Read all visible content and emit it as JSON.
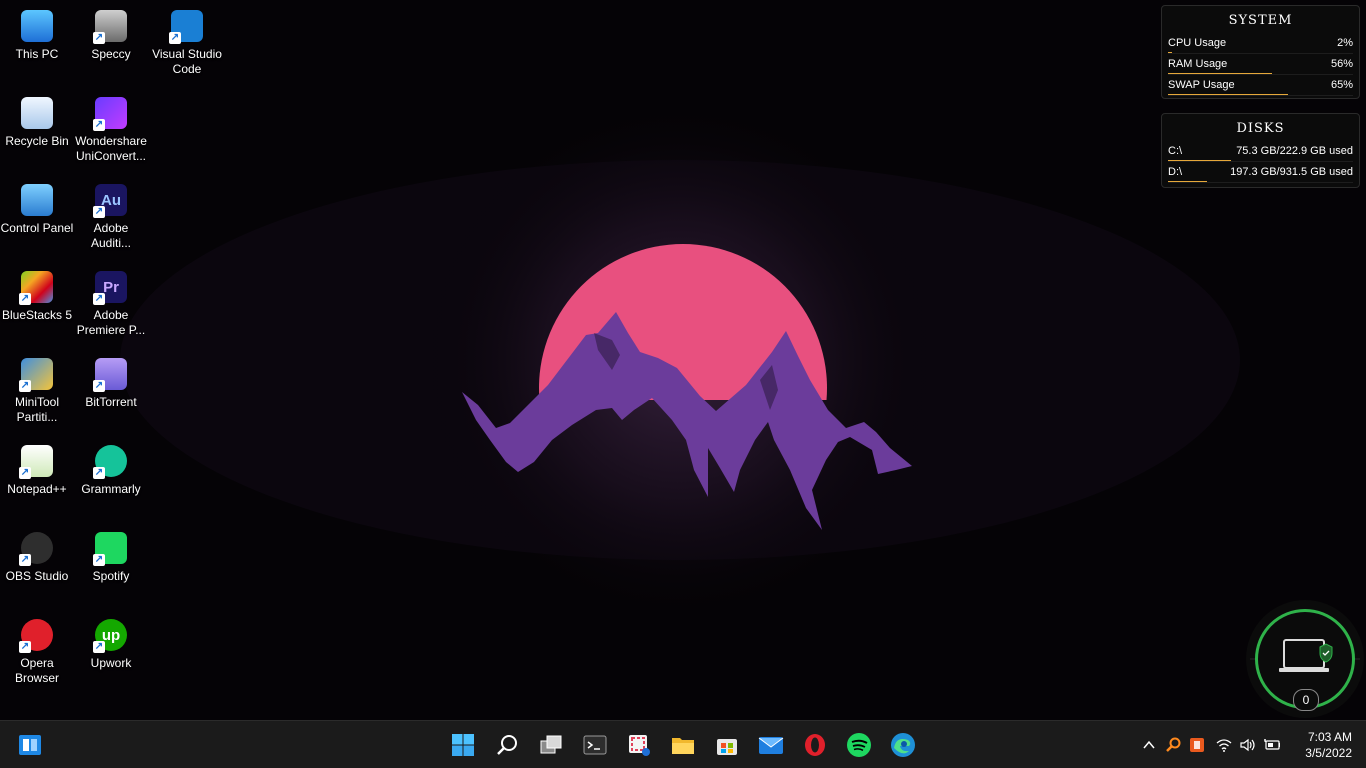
{
  "desktop": {
    "icons": [
      {
        "label": "This PC",
        "icon": "monitor-icon"
      },
      {
        "label": "Speccy",
        "icon": "speccy-icon"
      },
      {
        "label": "Visual Studio Code",
        "icon": "vscode-icon"
      },
      {
        "label": "Recycle Bin",
        "icon": "recycle-bin-icon"
      },
      {
        "label": "Wondershare UniConvert...",
        "icon": "uniconverter-icon"
      },
      {
        "label": "Control Panel",
        "icon": "control-panel-icon"
      },
      {
        "label": "Adobe Auditi...",
        "icon": "audition-icon",
        "glyph_text": "Au"
      },
      {
        "label": "BlueStacks 5",
        "icon": "bluestacks-icon"
      },
      {
        "label": "Adobe Premiere P...",
        "icon": "premiere-icon",
        "glyph_text": "Pr"
      },
      {
        "label": "MiniTool Partiti...",
        "icon": "minitool-icon"
      },
      {
        "label": "BitTorrent",
        "icon": "bittorrent-icon"
      },
      {
        "label": "Notepad++",
        "icon": "notepadpp-icon"
      },
      {
        "label": "Grammarly",
        "icon": "grammarly-icon"
      },
      {
        "label": "OBS Studio",
        "icon": "obs-icon"
      },
      {
        "label": "Spotify",
        "icon": "spotify-icon"
      },
      {
        "label": "Opera Browser",
        "icon": "opera-icon"
      },
      {
        "label": "Upwork",
        "icon": "upwork-icon",
        "glyph_text": "up"
      }
    ]
  },
  "system_widget": {
    "title": "SYSTEM",
    "rows": [
      {
        "label": "CPU Usage",
        "value": "2%",
        "fraction": 0.02
      },
      {
        "label": "RAM Usage",
        "value": "56%",
        "fraction": 0.56
      },
      {
        "label": "SWAP Usage",
        "value": "65%",
        "fraction": 0.65
      }
    ]
  },
  "disks_widget": {
    "title": "DISKS",
    "rows": [
      {
        "label": "C:\\",
        "value": "75.3 GB/222.9 GB used",
        "fraction": 0.338
      },
      {
        "label": "D:\\",
        "value": "197.3 GB/931.5 GB used",
        "fraction": 0.212
      }
    ]
  },
  "security_gauge": {
    "count": "0",
    "icon": "laptop-shield-icon"
  },
  "taskbar": {
    "start_left_icon": "taskbar-manager-icon",
    "pinned": [
      {
        "name": "start-button",
        "icon": "windows-logo-icon"
      },
      {
        "name": "search-button",
        "icon": "search-icon"
      },
      {
        "name": "task-view-button",
        "icon": "task-view-icon"
      },
      {
        "name": "terminal-button",
        "icon": "terminal-icon"
      },
      {
        "name": "snipping-tool-button",
        "icon": "snipping-icon"
      },
      {
        "name": "file-explorer-button",
        "icon": "folder-icon"
      },
      {
        "name": "store-button",
        "icon": "store-icon"
      },
      {
        "name": "mail-button",
        "icon": "mail-icon"
      },
      {
        "name": "opera-button",
        "icon": "opera-icon"
      },
      {
        "name": "spotify-button",
        "icon": "spotify-icon"
      },
      {
        "name": "edge-button",
        "icon": "edge-icon"
      }
    ],
    "tray": {
      "icons": [
        "chevron-up-icon",
        "search-tray-icon",
        "office-icon",
        "wifi-icon",
        "volume-icon",
        "battery-icon"
      ]
    },
    "clock": {
      "time": "7:03 AM",
      "date": "3/5/2022"
    }
  },
  "colors": {
    "sun": "#e8507f",
    "mountain": "#6b3c9b",
    "accent_bar": "#e6a83a",
    "gauge_ring": "#2fb24a"
  }
}
